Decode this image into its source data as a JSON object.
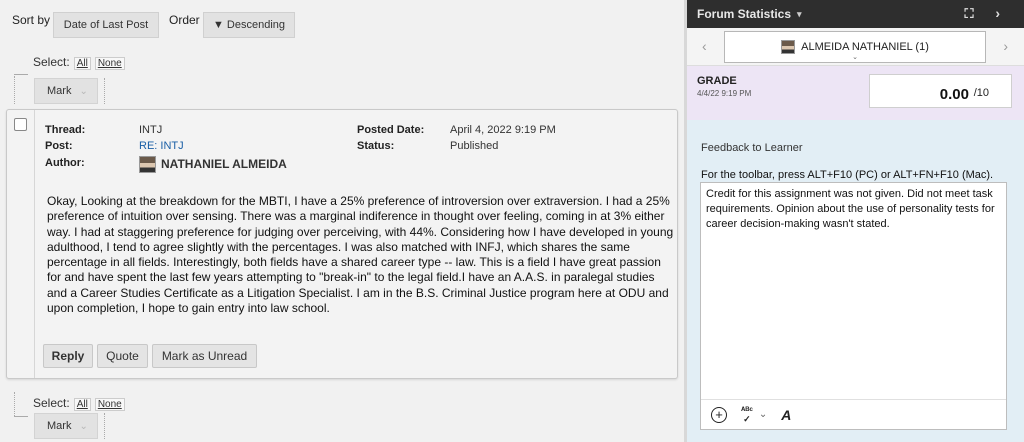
{
  "sort": {
    "sort_by_label": "Sort by",
    "sort_by_value": "Date of Last Post",
    "order_label": "Order",
    "order_value": "▼ Descending"
  },
  "select_top": {
    "label": "Select:",
    "all": "All",
    "none": "None",
    "mark": "Mark"
  },
  "select_bottom": {
    "label": "Select:",
    "all": "All",
    "none": "None",
    "mark": "Mark"
  },
  "post": {
    "thread_label": "Thread:",
    "thread_value": "INTJ",
    "post_label": "Post:",
    "post_value": "RE: INTJ",
    "author_label": "Author:",
    "author_value": "NATHANIEL ALMEIDA",
    "posted_date_label": "Posted Date:",
    "posted_date_value": "April 4, 2022 9:19 PM",
    "status_label": "Status:",
    "status_value": "Published",
    "body": "Okay, Looking at the breakdown for the MBTI, I have a 25% preference of introversion over extraversion. I had a 25% preference of intuition over sensing. There was a marginal indiference in thought over feeling, coming in at 3% either way. I had at staggering preference for judging over perceiving, with 44%. Considering how I have developed in young adulthood, I tend to agree slightly with the percentages. I was also matched with INFJ, which shares the same percentage in all fields. Interestingly, both fields have a shared career type -- law. This is a field I have great passion for and have spent the last few years attempting to \"break-in\" to the legal field.I have an A.A.S. in paralegal studies and a Career Studies Certificate as a Litigation Specialist. I am in the B.S. Criminal Justice program here at ODU and upon completion, I hope to gain entry into law school.",
    "reply_label": "Reply",
    "quote_label": "Quote",
    "mark_unread_label": "Mark as Unread"
  },
  "panel": {
    "title": "Forum Statistics",
    "user_label": "ALMEIDA NATHANIEL (1)",
    "grade_label": "GRADE",
    "grade_date": "4/4/22 9:19 PM",
    "grade_value": "0.00",
    "grade_max": "/10",
    "feedback_title": "Feedback to Learner",
    "toolbar_hint": "For the toolbar, press ALT+F10 (PC) or ALT+FN+F10 (Mac).",
    "feedback_text": "Credit for this assignment was not given. Did not meet task requirements. Opinion about the use of personality tests for career decision-making wasn't stated."
  },
  "icons": {
    "collapse": "caret-down-icon",
    "expand": "expand-icon",
    "next": "chevron-right-icon",
    "prev": "chevron-left-icon",
    "add": "plus-circle-icon",
    "spellcheck": "spellcheck-icon",
    "format": "text-format-icon"
  },
  "colors": {
    "panel_header_bg": "#2e2e2e",
    "grade_bg": "#ede5f5",
    "feedback_bg": "#e2eef5",
    "link": "#1a5fa6"
  }
}
